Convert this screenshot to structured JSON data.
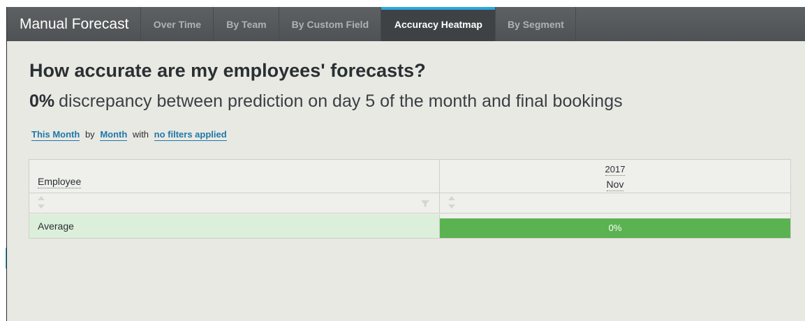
{
  "app": {
    "title": "Manual Forecast"
  },
  "tabs": [
    {
      "label": "Over Time"
    },
    {
      "label": "By Team"
    },
    {
      "label": "By Custom Field"
    },
    {
      "label": "Accuracy Heatmap",
      "active": true
    },
    {
      "label": "By Segment"
    }
  ],
  "heading": "How accurate are my employees' forecasts?",
  "summary": {
    "value": "0%",
    "text": "discrepancy between prediction on day 5 of the month and final bookings"
  },
  "filters": {
    "period": "This Month",
    "by_word": "by",
    "grouping": "Month",
    "with_word": "with",
    "filter_state": "no filters applied"
  },
  "table": {
    "employee_header": "Employee",
    "year": "2017",
    "month": "Nov",
    "rows": [
      {
        "label": "Average",
        "value": "0%"
      }
    ]
  },
  "colors": {
    "active_tab_accent": "#2aa7dc",
    "average_cell": "#5bb250",
    "average_row_bg": "#dcefdb",
    "link": "#1e78a8"
  },
  "icons": [
    "sort-up-icon",
    "sort-down-icon",
    "filter-icon"
  ]
}
